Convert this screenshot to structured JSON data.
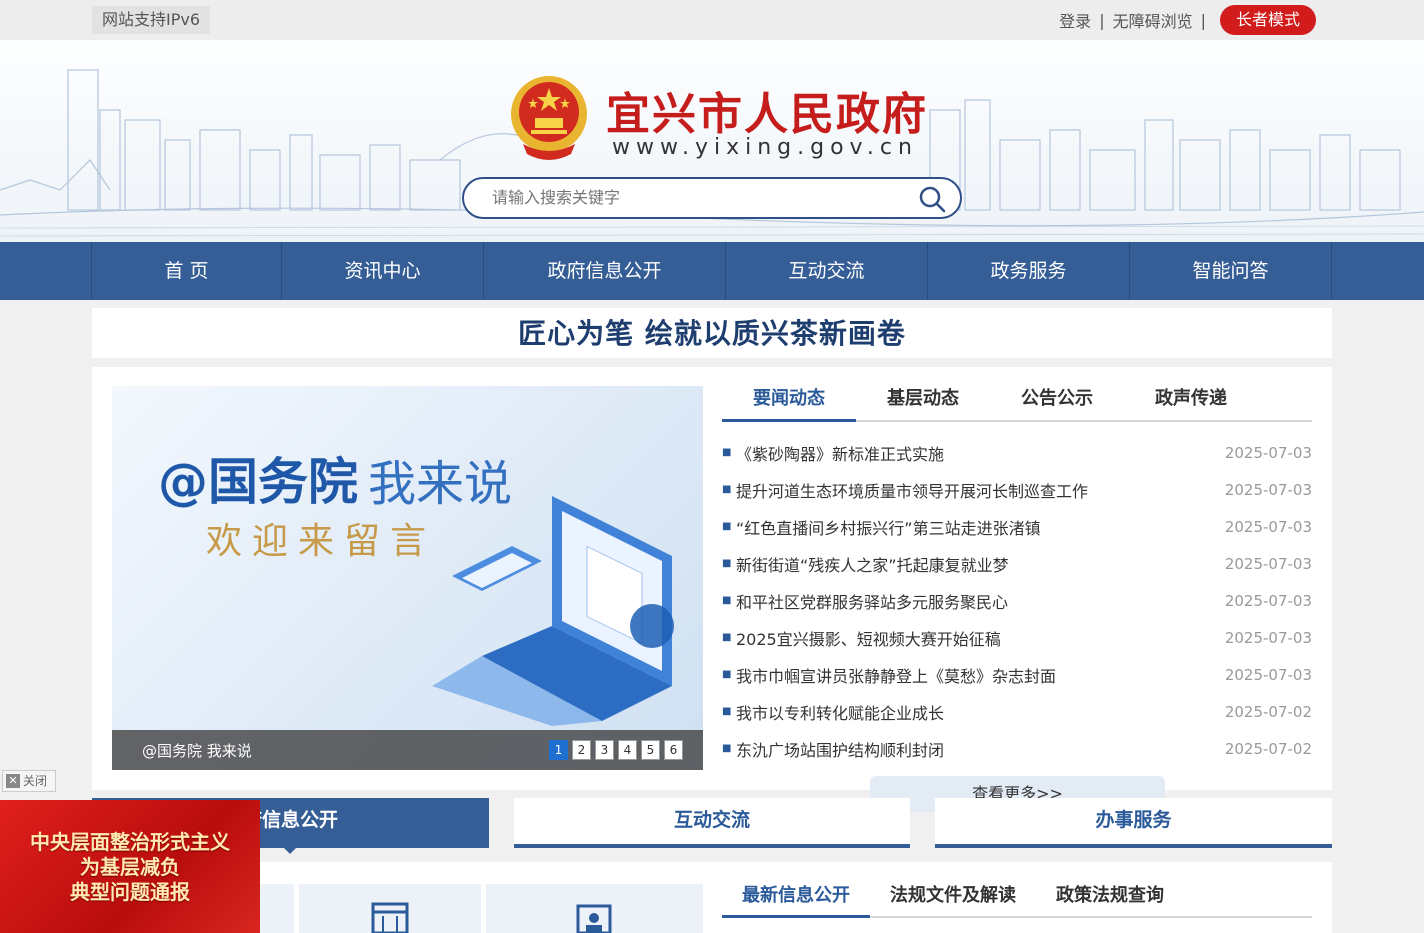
{
  "topbar": {
    "ipv6": "网站支持IPv6",
    "login": "登录",
    "accessible": "无障碍浏览",
    "elder": "长者模式",
    "sep": "|"
  },
  "header": {
    "title": "宜兴市人民政府",
    "url": "www.yixing.gov.cn",
    "search_placeholder": "请输入搜索关键字"
  },
  "nav": [
    {
      "label": "首 页",
      "w": 190
    },
    {
      "label": "资讯中心",
      "w": 202
    },
    {
      "label": "政府信息公开",
      "w": 242
    },
    {
      "label": "互动交流",
      "w": 202
    },
    {
      "label": "政务服务",
      "w": 202
    },
    {
      "label": "智能问答",
      "w": 202
    }
  ],
  "headline": "匠心为笔 绘就以质兴茶新画卷",
  "slide": {
    "heading": "@国务院",
    "heading2": "我来说",
    "sub": "欢迎来留言",
    "caption": "@国务院 我来说",
    "pages": [
      "1",
      "2",
      "3",
      "4",
      "5",
      "6"
    ]
  },
  "news_tabs": [
    "要闻动态",
    "基层动态",
    "公告公示",
    "政声传递"
  ],
  "news": [
    {
      "title": "《紫砂陶器》新标准正式实施",
      "date": "2025-07-03"
    },
    {
      "title": "提升河道生态环境质量市领导开展河长制巡查工作",
      "date": "2025-07-03"
    },
    {
      "title": "“红色直播间乡村振兴行”第三站走进张渚镇",
      "date": "2025-07-03"
    },
    {
      "title": "新街街道“残疾人之家”托起康复就业梦",
      "date": "2025-07-03"
    },
    {
      "title": "和平社区党群服务驿站多元服务聚民心",
      "date": "2025-07-03"
    },
    {
      "title": "2025宜兴摄影、短视频大赛开始征稿",
      "date": "2025-07-03"
    },
    {
      "title": "我市巾帼宣讲员张静静登上《莫愁》杂志封面",
      "date": "2025-07-03"
    },
    {
      "title": "我市以专利转化赋能企业成长",
      "date": "2025-07-02"
    },
    {
      "title": "东氿广场站围护结构顺利封闭",
      "date": "2025-07-02"
    }
  ],
  "more": "查看更多>>",
  "sections": [
    "府信息公开",
    "互动交流",
    "办事服务"
  ],
  "lower_tabs": [
    "最新信息公开",
    "法规文件及解读",
    "政策法规查询"
  ],
  "ad": {
    "close": "关闭",
    "lines": [
      "中央层面整治形式主义",
      "为基层减负",
      "典型问题通报"
    ]
  },
  "colors": {
    "brand": "#365e96",
    "accent": "#d21b1b"
  }
}
